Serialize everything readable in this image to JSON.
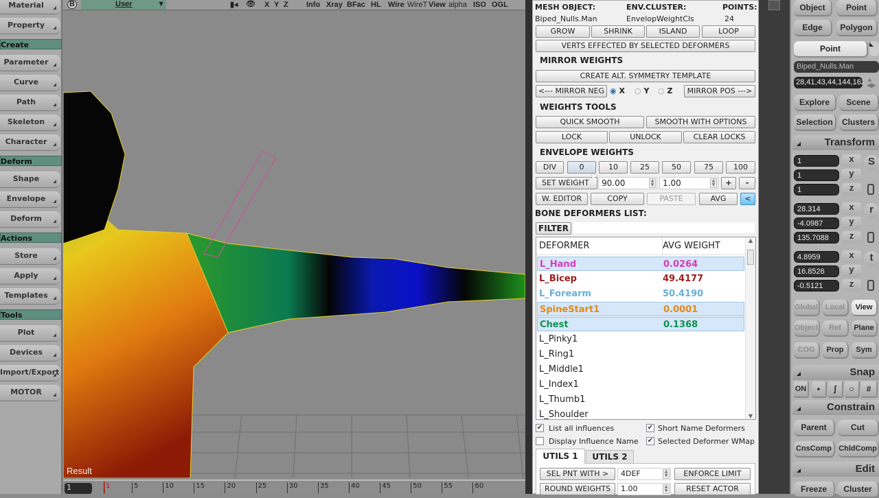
{
  "left_menu": [
    {
      "type": "button",
      "label": "Material"
    },
    {
      "type": "button",
      "label": "Property"
    },
    {
      "type": "header",
      "label": "Create"
    },
    {
      "type": "button",
      "label": "Parameter"
    },
    {
      "type": "button",
      "label": "Curve"
    },
    {
      "type": "button",
      "label": "Path"
    },
    {
      "type": "button",
      "label": "Skeleton"
    },
    {
      "type": "button",
      "label": "Character"
    },
    {
      "type": "header",
      "label": "Deform"
    },
    {
      "type": "button",
      "label": "Shape"
    },
    {
      "type": "button",
      "label": "Envelope"
    },
    {
      "type": "button",
      "label": "Deform"
    },
    {
      "type": "header",
      "label": "Actions"
    },
    {
      "type": "button",
      "label": "Store"
    },
    {
      "type": "button",
      "label": "Apply"
    },
    {
      "type": "button",
      "label": "Templates"
    },
    {
      "type": "header",
      "label": "Tools"
    },
    {
      "type": "button",
      "label": "Plot"
    },
    {
      "type": "button",
      "label": "Devices"
    },
    {
      "type": "button",
      "label": "Import/Export"
    },
    {
      "type": "button",
      "label": "MOTOR"
    }
  ],
  "toolbar": {
    "viewport_letter": "B",
    "camera": "User",
    "axes": [
      "X",
      "Y",
      "Z"
    ],
    "modes": [
      "Info",
      "Xray",
      "BFac",
      "HL",
      "Wire",
      "WireT",
      "View",
      "alpha",
      "ISO",
      "OGL"
    ]
  },
  "viewport": {
    "result_label": "Result"
  },
  "timeline": {
    "current_frame": "1",
    "ticks": [
      "1",
      "5",
      "10",
      "15",
      "20",
      "25",
      "30",
      "35",
      "40",
      "45",
      "50",
      "55",
      "60"
    ]
  },
  "dialog": {
    "mesh_object_label": "MESH OBJECT:",
    "mesh_object": "Biped_Nulls.Man",
    "env_cluster_label": "ENV.CLUSTER:",
    "env_cluster": "EnvelopWeightCls",
    "points_label": "POINTS:",
    "points": "24",
    "select_buttons": [
      "GROW",
      "SHRINK",
      "ISLAND",
      "LOOP"
    ],
    "verts_button": "VERTS EFFECTED BY SELECTED DEFORMERS",
    "mirror": {
      "title": "MIRROR WEIGHTS",
      "template_button": "CREATE ALT. SYMMETRY TEMPLATE",
      "neg_button": "<--- MIRROR NEG",
      "pos_button": "MIRROR POS --->",
      "axes": [
        "X",
        "Y",
        "Z"
      ],
      "selected_axis": "X"
    },
    "weights_tools": {
      "title": "WEIGHTS TOOLS",
      "quick_smooth": "QUICK SMOOTH",
      "smooth_options": "SMOOTH WITH OPTIONS",
      "lock": "LOCK",
      "unlock": "UNLOCK",
      "clear_locks": "CLEAR LOCKS"
    },
    "envelope": {
      "title": "ENVELOPE WEIGHTS",
      "presets": [
        "DIV",
        "0",
        "10",
        "25",
        "50",
        "75",
        "100"
      ],
      "set_weight": "SET WEIGHT",
      "weight_value": "90.00",
      "step_value": "1.00",
      "plus": "+",
      "minus": "-",
      "w_editor": "W. EDITOR",
      "copy": "COPY",
      "paste": "PASTE",
      "avg": "AVG",
      "back": "<"
    },
    "bone_list": {
      "title": "BONE DEFORMERS LIST:",
      "filter_button": "FILTER",
      "filter_value": "",
      "col_deformer": "DEFORMER",
      "col_avg": "AVG WEIGHT",
      "rows": [
        {
          "name": "L_Hand",
          "avg": "0.0264",
          "color": "#d23cb8",
          "selected": true
        },
        {
          "name": "L_Bicep",
          "avg": "49.4177",
          "color": "#9e1c1c",
          "selected": false
        },
        {
          "name": "L_Forearm",
          "avg": "50.4190",
          "color": "#6aaed8",
          "selected": false
        },
        {
          "name": "SpineStart1",
          "avg": "0.0001",
          "color": "#e0891a",
          "selected": true
        },
        {
          "name": "Chest",
          "avg": "0.1368",
          "color": "#0e9150",
          "selected": true
        },
        {
          "name": "L_Pinky1",
          "avg": "",
          "color": "#222222",
          "selected": false
        },
        {
          "name": "L_Ring1",
          "avg": "",
          "color": "#222222",
          "selected": false
        },
        {
          "name": "L_Middle1",
          "avg": "",
          "color": "#222222",
          "selected": false
        },
        {
          "name": "L_Index1",
          "avg": "",
          "color": "#222222",
          "selected": false
        },
        {
          "name": "L_Thumb1",
          "avg": "",
          "color": "#222222",
          "selected": false
        },
        {
          "name": "L_Shoulder",
          "avg": "",
          "color": "#222222",
          "selected": false
        }
      ]
    },
    "options": {
      "list_all": "List all influences",
      "list_all_checked": true,
      "short_name": "Short Name Deformers",
      "short_name_checked": true,
      "display_influence": "Display Influence Name",
      "display_influence_checked": false,
      "selected_wmap": "Selected Deformer WMap",
      "selected_wmap_checked": true
    },
    "tabs": [
      "UTILS 1",
      "UTILS 2"
    ],
    "utils": {
      "sel_pnt": "SEL PNT WITH >",
      "sel_value": "4DEF",
      "enforce": "ENFORCE LIMIT",
      "round": "ROUND WEIGHTS",
      "round_value": "1.00",
      "reset": "RESET ACTOR"
    }
  },
  "right_panel": {
    "select_modes": [
      "Object",
      "Point",
      "Edge",
      "Polygon"
    ],
    "active_filter": "Point",
    "object_name": "Biped_Nulls.Man",
    "selection_ids": "28,41,43,44,144,162,",
    "nav": [
      "Explore",
      "Scene",
      "Selection",
      "Clusters"
    ],
    "transform_title": "Transform",
    "scale": {
      "label": "S",
      "x": "1",
      "y": "1",
      "z": "1"
    },
    "rotate": {
      "label": "r",
      "x": "28.314",
      "y": "-4.0987",
      "z": "135.7088"
    },
    "translate": {
      "label": "t",
      "x": "4.8959",
      "y": "16.8526",
      "z": "-0.5121"
    },
    "axis_labels": [
      "x",
      "y",
      "z"
    ],
    "ref_modes": [
      "Global",
      "Local",
      "View",
      "Object",
      "Ref",
      "Plane"
    ],
    "active_ref": "View",
    "cog_buttons": [
      "COG",
      "Prop",
      "Sym"
    ],
    "snap_title": "Snap",
    "snap_on": "ON",
    "constrain_title": "Constrain",
    "constrain_buttons": [
      "Parent",
      "Cut",
      "CnsComp",
      "ChldComp"
    ],
    "edit_title": "Edit",
    "edit_buttons": [
      "Freeze",
      "Cluster"
    ]
  }
}
